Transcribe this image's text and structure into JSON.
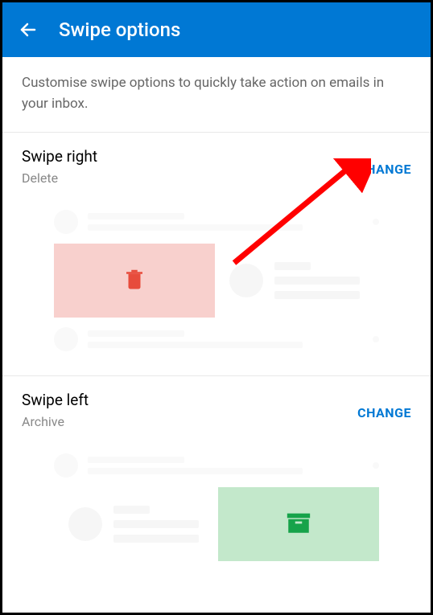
{
  "header": {
    "title": "Swipe options"
  },
  "description": "Customise swipe options to quickly take action on emails in your inbox.",
  "sections": {
    "swipeRight": {
      "title": "Swipe right",
      "action": "Delete",
      "changeLabel": "CHANGE"
    },
    "swipeLeft": {
      "title": "Swipe left",
      "action": "Archive",
      "changeLabel": "CHANGE"
    }
  },
  "colors": {
    "primary": "#0078d4",
    "deleteBg": "#f8d0cd",
    "deleteIcon": "#e74c3c",
    "archiveBg": "#c3e8cb",
    "archiveIcon": "#16a34a",
    "arrow": "#ff0000"
  }
}
